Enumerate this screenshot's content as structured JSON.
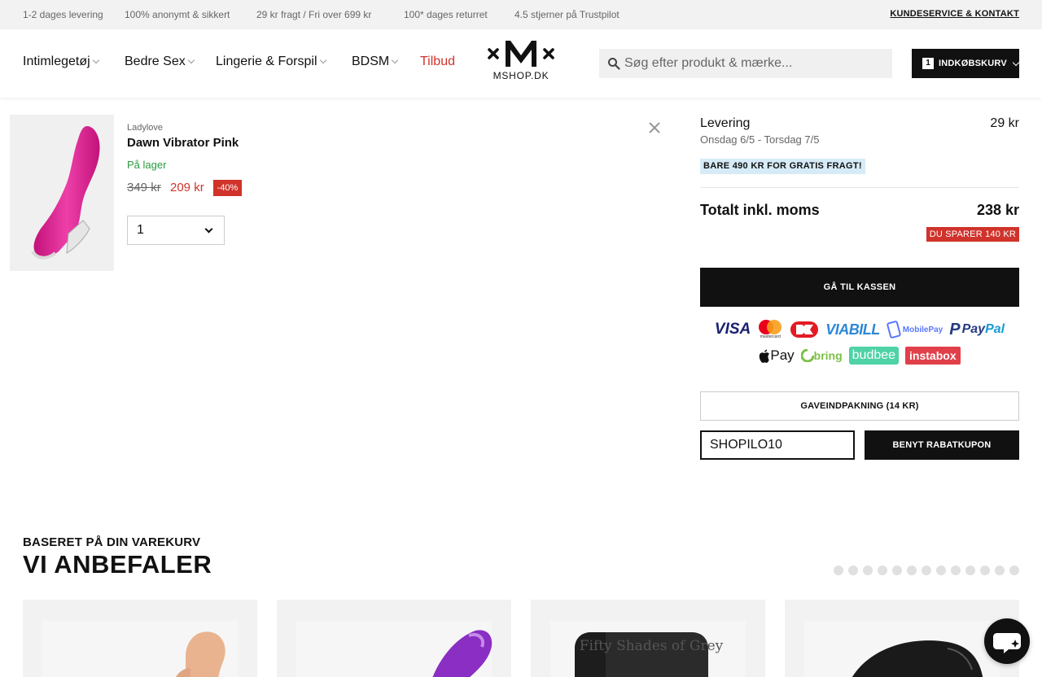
{
  "topbar": {
    "usps": [
      "1-2 dages levering",
      "100% anonymt & sikkert",
      "29 kr fragt / Fri over 699 kr",
      "100* dages returret",
      "4.5 stjerner på Trustpilot"
    ],
    "service_link": "KUNDESERVICE & KONTAKT"
  },
  "header": {
    "nav": [
      {
        "label": "Intimlegetøj",
        "icon": "chevron-down-icon"
      },
      {
        "label": "Bedre Sex",
        "icon": "chevron-down-icon"
      },
      {
        "label": "Lingerie & Forspil",
        "icon": "chevron-down-icon"
      },
      {
        "label": "BDSM",
        "icon": "chevron-down-icon"
      },
      {
        "label": "Tilbud"
      }
    ],
    "logo_text": "MSHOP.DK",
    "search_placeholder": "Søg efter produkt & mærke...",
    "cart_count": "1",
    "cart_label": "INDKØBSKURV"
  },
  "cart_item": {
    "brand": "Ladylove",
    "name": "Dawn Vibrator Pink",
    "stock": "På lager",
    "old_price": "349 kr",
    "new_price": "209 kr",
    "discount": "-40%",
    "quantity": "1"
  },
  "summary": {
    "delivery_label": "Levering",
    "delivery_price": "29 kr",
    "delivery_dates": "Onsdag 6/5 - Torsdag 7/5",
    "free_shipping_note": "BARE 490 KR FOR GRATIS FRAGT!",
    "total_label": "Totalt inkl. moms",
    "total_value": "238 kr",
    "savings": "DU SPARER 140 KR",
    "checkout_label": "GÅ TIL KASSEN",
    "payment_methods": {
      "visa": "VISA",
      "mastercard_caption": "mastercard",
      "viabill": "VIABILL",
      "mobilepay": "MobilePay",
      "paypal_a": "Pay",
      "paypal_b": "Pal",
      "applepay": "Pay",
      "bring": "bring",
      "budbee": "budbee",
      "instabox": "instabox"
    },
    "gift_wrap_label": "GAVEINDPAKNING (14 KR)",
    "coupon_value": "SHOPILO10",
    "coupon_button": "BENYT RABATKUPON"
  },
  "recommendations": {
    "subtitle": "BASERET PÅ DIN VAREKURV",
    "title": "VI ANBEFALER",
    "dot_count": 13,
    "card_texts": [
      "Fifty Shades of Grey"
    ]
  },
  "colors": {
    "accent_red": "#d0332b",
    "stock_green": "#2a9a3f",
    "button_black": "#111111",
    "free_shipping_bg": "#d6ebf7"
  }
}
